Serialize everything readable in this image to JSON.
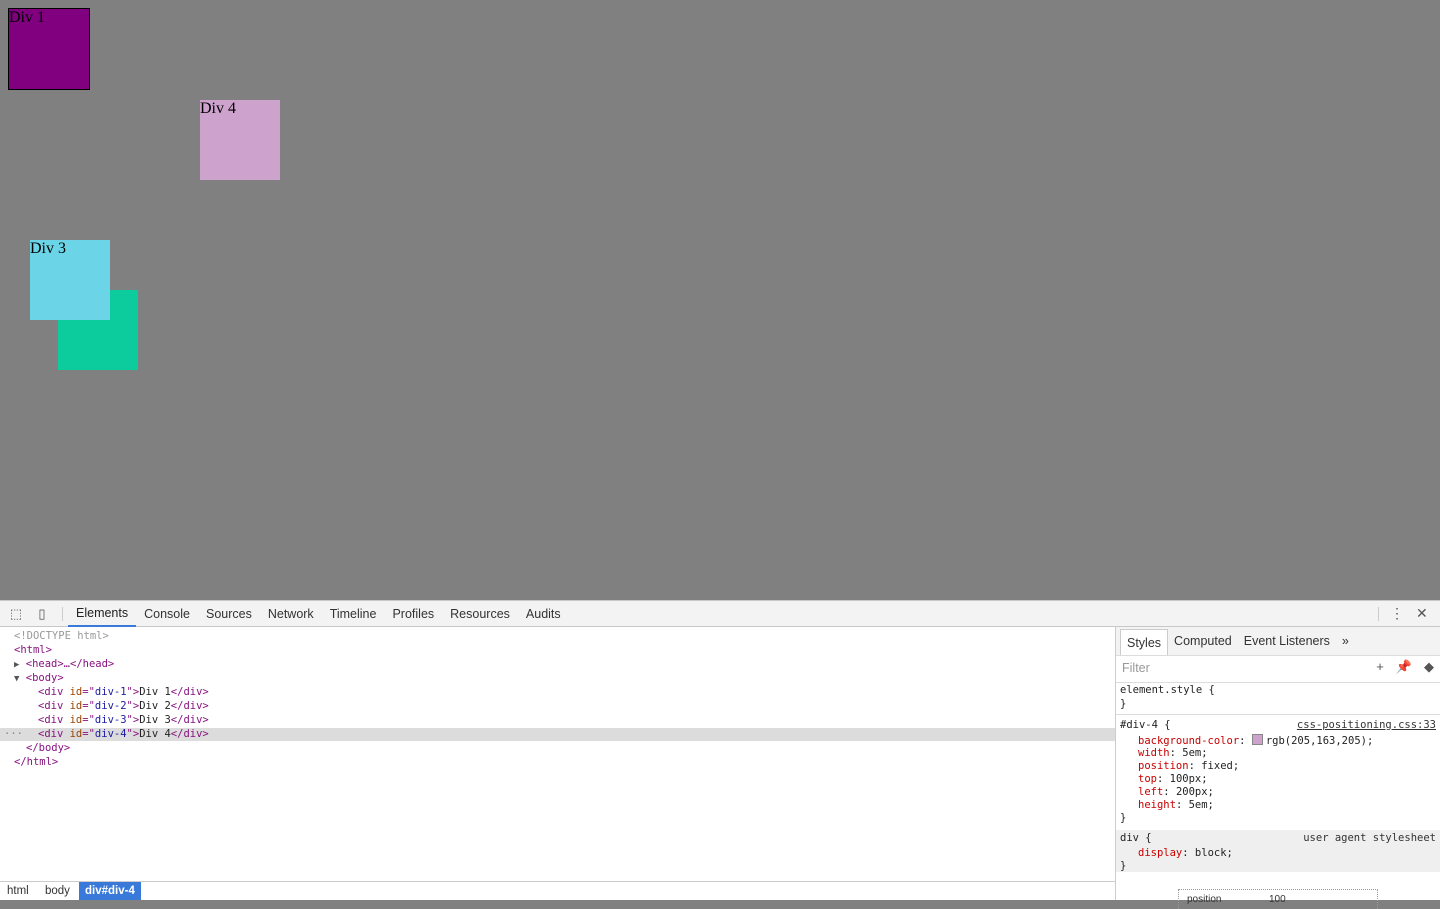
{
  "viewport": {
    "div1": {
      "label": "Div 1",
      "color": "#800080"
    },
    "div2": {
      "label": "",
      "color": "#0ccc9d"
    },
    "div3": {
      "label": "Div 3",
      "color": "#6bd4e6"
    },
    "div4": {
      "label": "Div 4",
      "color": "#cda3cd"
    }
  },
  "devtools": {
    "tabs": [
      "Elements",
      "Console",
      "Sources",
      "Network",
      "Timeline",
      "Profiles",
      "Resources",
      "Audits"
    ],
    "active_tab": "Elements",
    "dom": {
      "doctype": "<!DOCTYPE html>",
      "html_open": "<html>",
      "head": "<head>…</head>",
      "body_open": "<body>",
      "divs": [
        {
          "id": "div-1",
          "text": "Div 1"
        },
        {
          "id": "div-2",
          "text": "Div 2"
        },
        {
          "id": "div-3",
          "text": "Div 3"
        },
        {
          "id": "div-4",
          "text": "Div 4"
        }
      ],
      "body_close": "</body>",
      "html_close": "</html>"
    },
    "breadcrumbs": [
      "html",
      "body",
      "div#div-4"
    ],
    "styles": {
      "tabs": [
        "Styles",
        "Computed",
        "Event Listeners",
        "»"
      ],
      "filter_placeholder": "Filter",
      "element_style": "element.style {",
      "close_brace": "}",
      "rule_selector": "#div-4 {",
      "rule_source": "css-positioning.css:33",
      "props": [
        {
          "name": "background-color",
          "value": "rgb(205,163,205);"
        },
        {
          "name": "width",
          "value": "5em;"
        },
        {
          "name": "position",
          "value": "fixed;"
        },
        {
          "name": "top",
          "value": "100px;"
        },
        {
          "name": "left",
          "value": "200px;"
        },
        {
          "name": "height",
          "value": "5em;"
        }
      ],
      "ua_selector": "div {",
      "ua_source": "user agent stylesheet",
      "ua_prop": {
        "name": "display",
        "value": "block;"
      },
      "boxmodel_label": "position",
      "boxmodel_value": "100"
    }
  }
}
